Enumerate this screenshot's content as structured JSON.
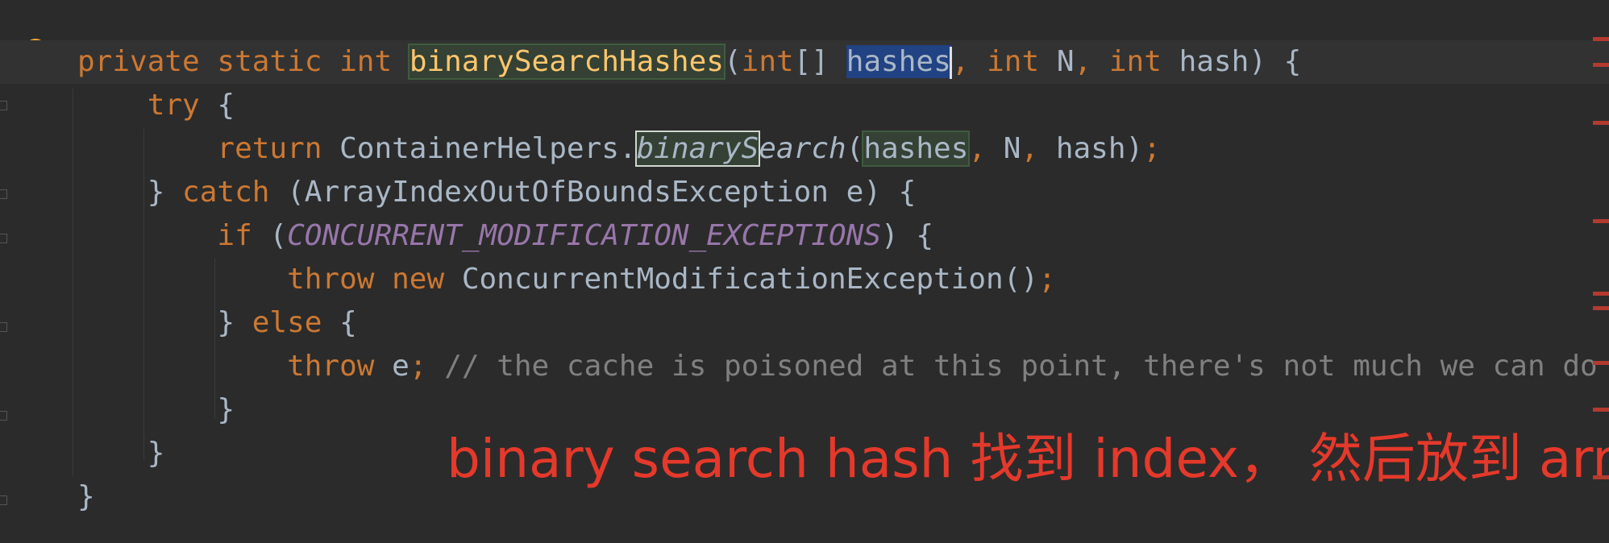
{
  "code_lines": [
    {
      "tokens": [
        {
          "t": "private static int ",
          "c": "kw"
        },
        {
          "t": "binarySearchHashes",
          "c": "fn hl-green"
        },
        {
          "t": "(",
          "c": "txt"
        },
        {
          "t": "int",
          "c": "kw"
        },
        {
          "t": "[] ",
          "c": "txt"
        },
        {
          "t": "hashes",
          "c": "txt hl-blue"
        },
        {
          "t": "",
          "c": "caret"
        },
        {
          "t": ", ",
          "c": "kw"
        },
        {
          "t": "int ",
          "c": "kw"
        },
        {
          "t": "N",
          "c": "txt"
        },
        {
          "t": ", ",
          "c": "kw"
        },
        {
          "t": "int ",
          "c": "kw"
        },
        {
          "t": "hash) {",
          "c": "txt"
        }
      ]
    },
    {
      "tokens": [
        {
          "t": "    try ",
          "c": "kw"
        },
        {
          "t": "{",
          "c": "txt"
        }
      ]
    },
    {
      "tokens": [
        {
          "t": "        return ",
          "c": "kw"
        },
        {
          "t": "ContainerHelpers.",
          "c": "txt"
        },
        {
          "t": "binaryS",
          "c": "txt ital hl-box"
        },
        {
          "t": "earch",
          "c": "txt ital"
        },
        {
          "t": "(",
          "c": "txt"
        },
        {
          "t": "hashes",
          "c": "txt hl-green"
        },
        {
          "t": ", ",
          "c": "kw"
        },
        {
          "t": "N",
          "c": "txt"
        },
        {
          "t": ", ",
          "c": "kw"
        },
        {
          "t": "hash)",
          "c": "txt"
        },
        {
          "t": ";",
          "c": "kw"
        }
      ]
    },
    {
      "tokens": [
        {
          "t": "    } ",
          "c": "txt"
        },
        {
          "t": "catch ",
          "c": "kw"
        },
        {
          "t": "(ArrayIndexOutOfBoundsException e) {",
          "c": "txt"
        }
      ]
    },
    {
      "tokens": [
        {
          "t": "        if ",
          "c": "kw"
        },
        {
          "t": "(",
          "c": "txt"
        },
        {
          "t": "CONCURRENT_MODIFICATION_EXCEPTIONS",
          "c": "const"
        },
        {
          "t": ") {",
          "c": "txt"
        }
      ]
    },
    {
      "tokens": [
        {
          "t": "            throw new ",
          "c": "kw"
        },
        {
          "t": "ConcurrentModificationException()",
          "c": "txt"
        },
        {
          "t": ";",
          "c": "kw"
        }
      ]
    },
    {
      "tokens": [
        {
          "t": "        } ",
          "c": "txt"
        },
        {
          "t": "else ",
          "c": "kw"
        },
        {
          "t": "{",
          "c": "txt"
        }
      ]
    },
    {
      "tokens": [
        {
          "t": "            throw ",
          "c": "kw"
        },
        {
          "t": "e",
          "c": "txt"
        },
        {
          "t": "; ",
          "c": "kw"
        },
        {
          "t": "// the cache is poisoned at this point, there's not much we can do",
          "c": "cmt"
        }
      ]
    },
    {
      "tokens": [
        {
          "t": "        }",
          "c": "txt"
        }
      ]
    },
    {
      "tokens": [
        {
          "t": "    }",
          "c": "txt"
        }
      ]
    },
    {
      "tokens": [
        {
          "t": "}",
          "c": "txt"
        }
      ]
    }
  ],
  "annotation": "binary search hash 找到 index， 然后放到 array",
  "icons": {
    "gutter": "lightbulb-icon"
  },
  "colors": {
    "keyword": "#cc7832",
    "function": "#ffc66d",
    "text": "#a9b7c6",
    "comment": "#808080",
    "constant": "#9876aa",
    "annotation": "#e4392b"
  }
}
